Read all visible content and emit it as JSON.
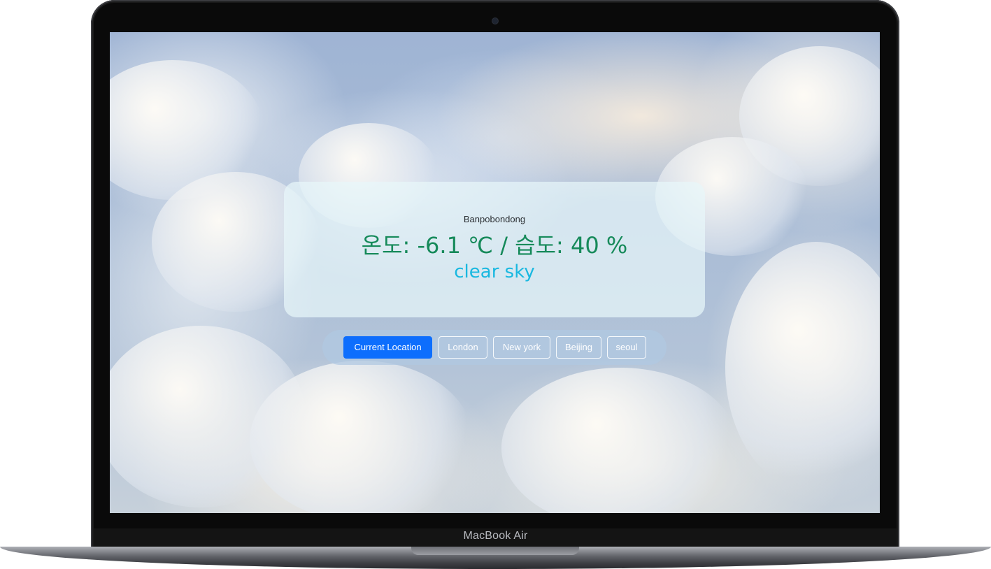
{
  "device": {
    "label": "MacBook Air"
  },
  "weather": {
    "location": "Banpobondong",
    "temperature_humidity": "온도: -6.1 ℃ / 습도: 40 %",
    "description": "clear sky"
  },
  "cities": {
    "buttons": [
      {
        "label": "Current Location",
        "active": true
      },
      {
        "label": "London",
        "active": false
      },
      {
        "label": "New york",
        "active": false
      },
      {
        "label": "Beijing",
        "active": false
      },
      {
        "label": "seoul",
        "active": false
      }
    ]
  },
  "colors": {
    "temperature_text": "#168a5a",
    "description_text": "#19b8e0",
    "active_button": "#0d6efd"
  }
}
